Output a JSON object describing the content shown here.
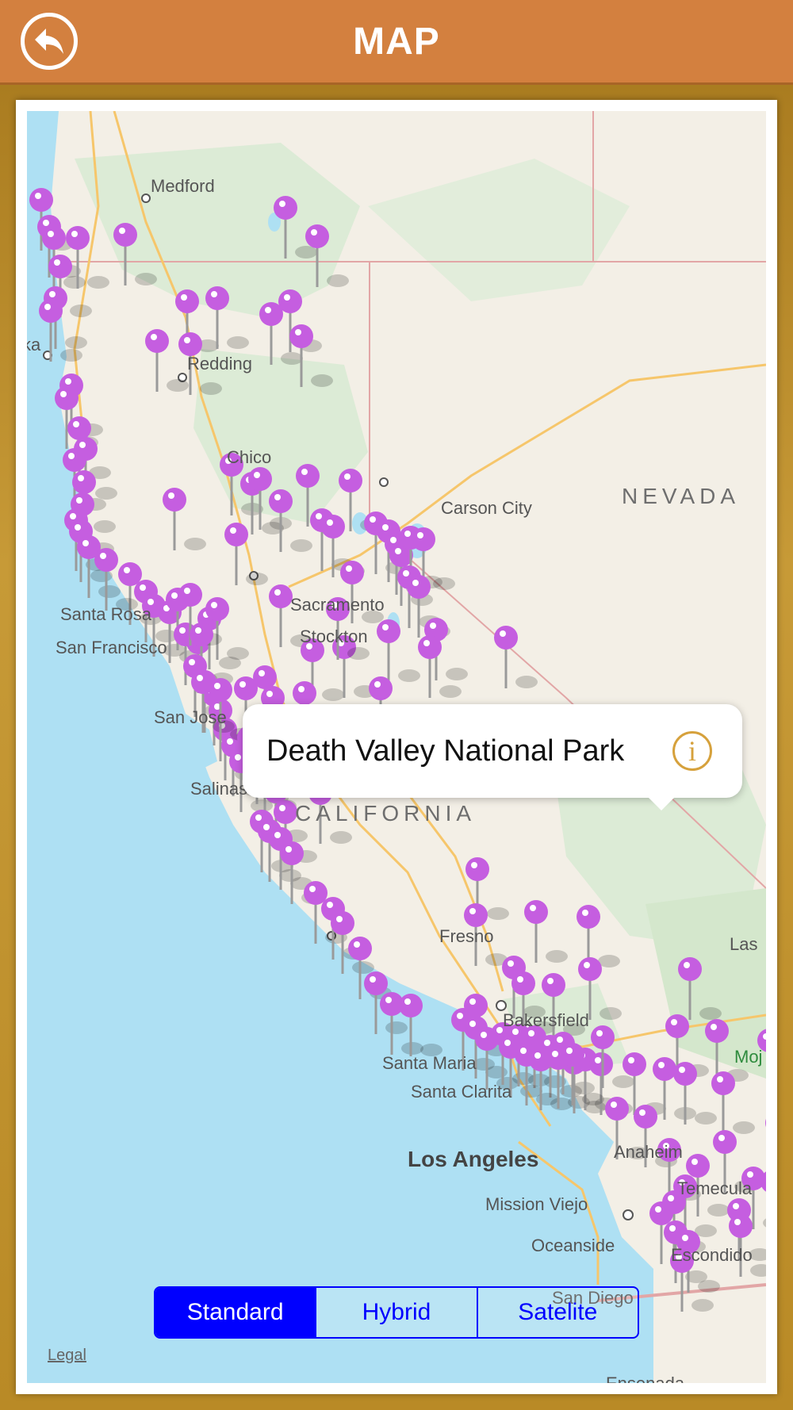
{
  "header": {
    "title": "MAP",
    "back_icon": "back-arrow-icon"
  },
  "map": {
    "labels": {
      "medford": "Medford",
      "redding": "Redding",
      "chico": "Chico",
      "sacramento": "Sacramento",
      "santa_rosa": "Santa Rosa",
      "san_francisco": "San Francisco",
      "san_jose": "San Jose",
      "salinas": "Salinas",
      "fresno": "Fresno",
      "carson_city": "Carson City",
      "nevada": "NEVADA",
      "california": "CALIFORNIA",
      "las": "Las",
      "bakersfield": "Bakersfield",
      "santa_maria": "Santa Maria",
      "santa_clarita": "Santa Clarita",
      "los_angeles": "Los Angeles",
      "anaheim": "Anaheim",
      "mission_viejo": "Mission Viejo",
      "temecula": "Temecula",
      "oceanside": "Oceanside",
      "escondido": "Escondido",
      "san_diego": "San Diego",
      "ensenada": "Ensenada",
      "mojave": "Moj",
      "eureka": "ka",
      "stockton": "Stockton"
    },
    "callout": {
      "title": "Death Valley National Park",
      "info_icon": "info-icon"
    },
    "map_types": [
      "Standard",
      "Hybrid",
      "Satelite"
    ],
    "selected_map_type": "Standard",
    "legal": "Legal",
    "pin_color": "#c55ee0"
  }
}
